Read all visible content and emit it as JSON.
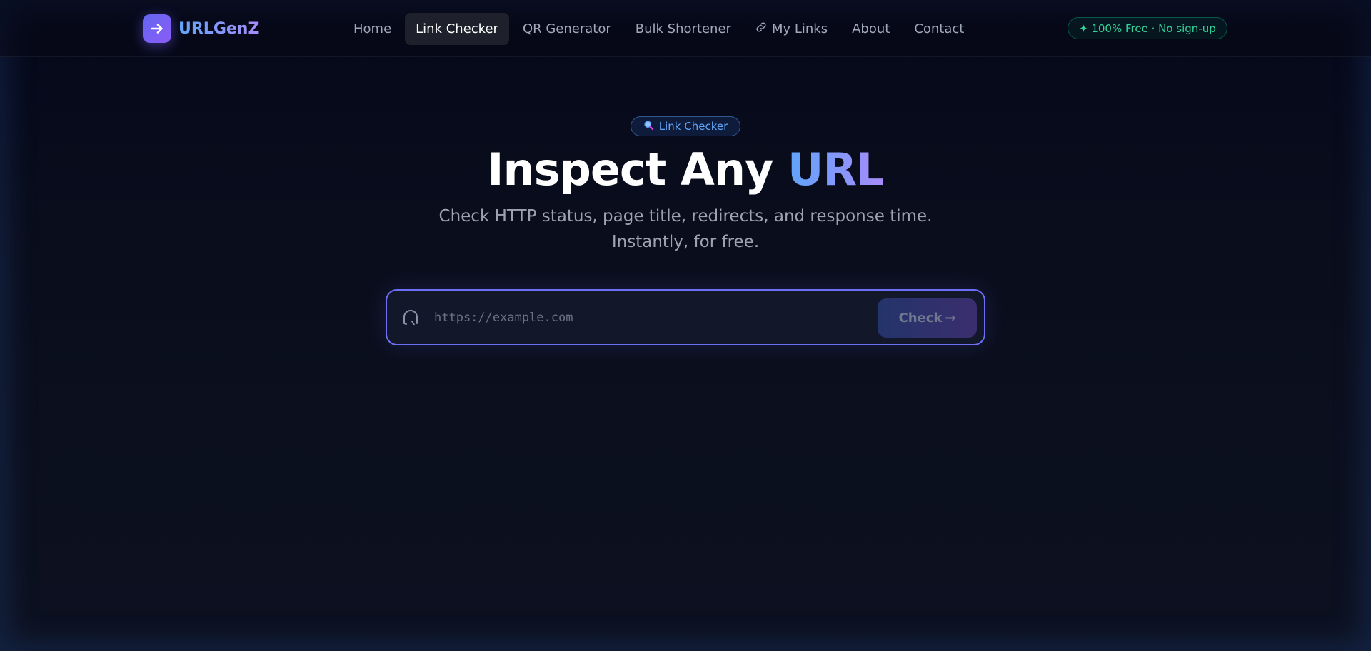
{
  "brand": {
    "name": "URLGenZ",
    "logo_icon": "arrow-right-icon"
  },
  "nav": {
    "items": [
      {
        "label": "Home",
        "active": false
      },
      {
        "label": "Link Checker",
        "active": true
      },
      {
        "label": "QR Generator",
        "active": false
      },
      {
        "label": "Bulk Shortener",
        "active": false
      },
      {
        "label": "My Links",
        "active": false,
        "icon": "link-icon"
      },
      {
        "label": "About",
        "active": false
      },
      {
        "label": "Contact",
        "active": false
      }
    ]
  },
  "badge": {
    "text": "✦ 100% Free · No sign-up"
  },
  "hero": {
    "pill_icon": "magnifier-icon",
    "pill_label": "Link Checker",
    "title_main": "Inspect Any ",
    "title_accent": "URL",
    "subtitle_line1": "Check HTTP status, page title, redirects, and response time.",
    "subtitle_line2": "Instantly, for free."
  },
  "search": {
    "placeholder": "https://example.com",
    "value": "",
    "icon": "headset-icon",
    "button_label": "Check",
    "button_arrow": "→"
  },
  "colors": {
    "accent_blue": "#60a5fa",
    "accent_violet": "#a78bfa",
    "brand_gradient_start": "#6366f1",
    "brand_gradient_end": "#8b5cf6",
    "success_green": "#34d399",
    "background": "#0a0e1a"
  }
}
